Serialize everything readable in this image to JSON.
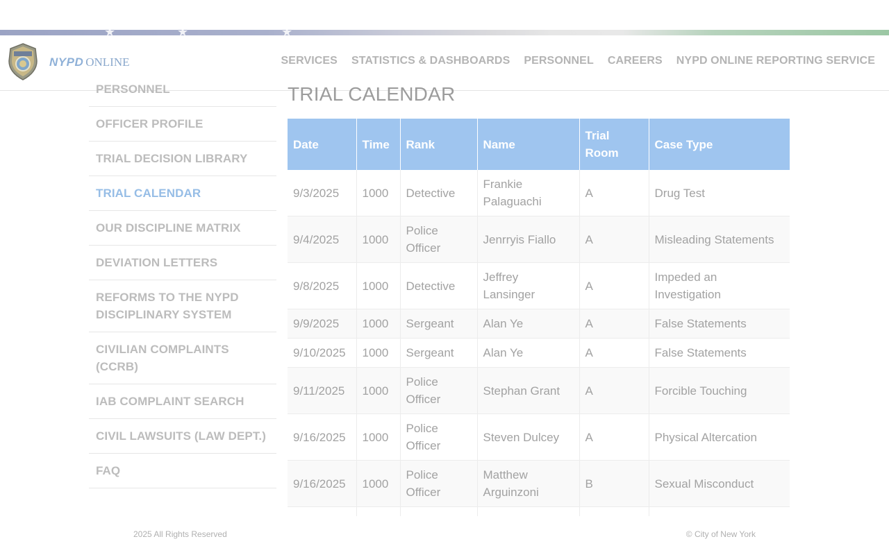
{
  "brand": {
    "nypd": "NYPD",
    "online": "ONLINE"
  },
  "top_nav": [
    {
      "label": "SERVICES"
    },
    {
      "label": "STATISTICS & DASHBOARDS"
    },
    {
      "label": "PERSONNEL"
    },
    {
      "label": "CAREERS"
    },
    {
      "label": "NYPD ONLINE REPORTING SERVICE"
    }
  ],
  "side_nav": {
    "active": "TRIAL CALENDAR",
    "items": [
      {
        "label": "PERSONNEL"
      },
      {
        "label": "OFFICER PROFILE"
      },
      {
        "label": "TRIAL DECISION LIBRARY"
      },
      {
        "label": "TRIAL CALENDAR"
      },
      {
        "label": "OUR DISCIPLINE MATRIX"
      },
      {
        "label": "DEVIATION LETTERS"
      },
      {
        "label": "REFORMS TO THE NYPD DISCIPLINARY SYSTEM"
      },
      {
        "label": "CIVILIAN COMPLAINTS (CCRB)"
      },
      {
        "label": "IAB COMPLAINT SEARCH"
      },
      {
        "label": "CIVIL LAWSUITS (LAW DEPT.)"
      },
      {
        "label": "FAQ"
      }
    ]
  },
  "page": {
    "title": "TRIAL CALENDAR"
  },
  "table": {
    "headers": [
      "Date",
      "Time",
      "Rank",
      "Name",
      "Trial Room",
      "Case Type"
    ],
    "rows": [
      [
        "9/3/2025",
        "1000",
        "Detective",
        "Frankie Palaguachi",
        "A",
        "Drug Test"
      ],
      [
        "9/4/2025",
        "1000",
        "Police Officer",
        "Jenrryis Fiallo",
        "A",
        "Misleading Statements"
      ],
      [
        "9/8/2025",
        "1000",
        "Detective",
        "Jeffrey Lansinger",
        "A",
        "Impeded an Investigation"
      ],
      [
        "9/9/2025",
        "1000",
        "Sergeant",
        "Alan Ye",
        "A",
        "False Statements"
      ],
      [
        "9/10/2025",
        "1000",
        "Sergeant",
        "Alan Ye",
        "A",
        "False Statements"
      ],
      [
        "9/11/2025",
        "1000",
        "Police Officer",
        "Stephan Grant",
        "A",
        "Forcible Touching"
      ],
      [
        "9/16/2025",
        "1000",
        "Police Officer",
        "Steven Dulcey",
        "A",
        "Physical Altercation"
      ],
      [
        "9/16/2025",
        "1000",
        "Police Officer",
        "Matthew Arguinzoni",
        "B",
        "Sexual Misconduct"
      ]
    ]
  },
  "footer": {
    "rights": "2025 All Rights Reserved",
    "city": "© City of New York"
  },
  "colors": {
    "header_bg": "#9fc5ef",
    "active_link": "#96bde6",
    "brand_blue": "#8fb1d8"
  },
  "icons": {
    "logo": "nypd-police-badge-icon"
  }
}
